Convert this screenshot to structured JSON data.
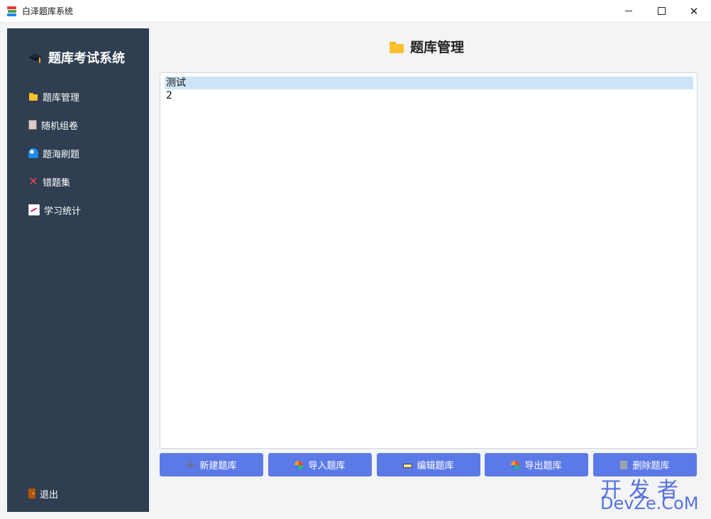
{
  "window": {
    "title": "白泽题库系统",
    "minimize_glyph": "—",
    "maximize_glyph": "☐",
    "close_glyph": "✕"
  },
  "sidebar": {
    "brand": "题库考试系统",
    "brand_icon": "graduation-cap-icon",
    "items": [
      {
        "label": "题库管理",
        "icon": "folder-icon"
      },
      {
        "label": "随机组卷",
        "icon": "clipboard-icon"
      },
      {
        "label": "题海刷题",
        "icon": "wave-icon"
      },
      {
        "label": "错题集",
        "icon": "cross-mark-icon"
      },
      {
        "label": "学习统计",
        "icon": "chart-icon"
      }
    ],
    "exit": {
      "label": "退出",
      "icon": "door-icon"
    },
    "background": "#2f3e50"
  },
  "main": {
    "title": "题库管理",
    "title_icon": "folder-icon",
    "list": {
      "items": [
        {
          "text": "测试",
          "selected": true
        },
        {
          "text": "2",
          "selected": false
        }
      ]
    },
    "buttons": [
      {
        "label": "新建题库",
        "icon": "plus-icon"
      },
      {
        "label": "导入题库",
        "icon": "import-icon"
      },
      {
        "label": "编辑题库",
        "icon": "edit-icon"
      },
      {
        "label": "导出题库",
        "icon": "export-icon"
      },
      {
        "label": "删除题库",
        "icon": "trash-icon"
      }
    ],
    "button_color": "#5b7ae8"
  },
  "watermark": {
    "top": "开发者",
    "bottom": "DevZe.CoM"
  }
}
